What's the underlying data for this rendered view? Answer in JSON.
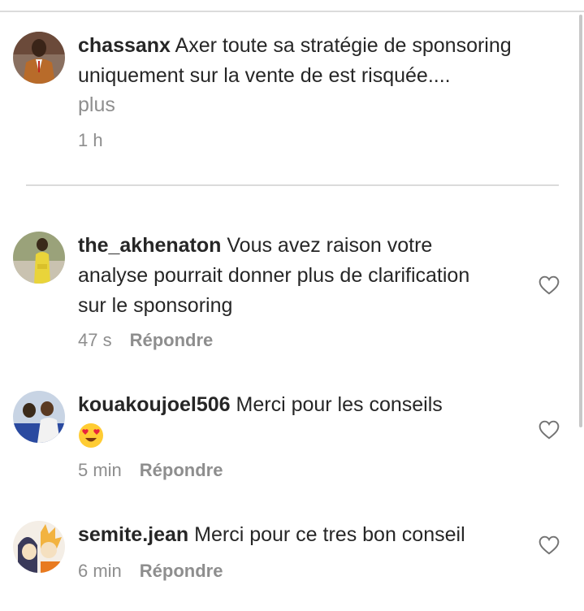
{
  "comments": [
    {
      "username": "chassanx",
      "text": " Axer toute sa stratégie de sponsoring uniquement sur la vente de est risquée....",
      "more": "plus",
      "time": "1 h",
      "reply": "",
      "avatar_colors": [
        "#6b4a3a",
        "#b86b2a",
        "#2a2a2a"
      ]
    },
    {
      "username": "the_akhenaton",
      "text": " Vous avez raison votre analyse pourrait donner plus de clarification sur le sponsoring",
      "time": "47 s",
      "reply": "Répondre",
      "avatar_colors": [
        "#7a8a5a",
        "#e9d43a",
        "#3a2a1a"
      ]
    },
    {
      "username": "kouakoujoel506",
      "text": " Merci pour les conseils",
      "emoji": "heart-eyes-emoji",
      "time": "5 min",
      "reply": "Répondre",
      "avatar_colors": [
        "#8aa0c8",
        "#2a4aa0",
        "#3a2a1a"
      ]
    },
    {
      "username": "semite.jean",
      "text": " Merci pour ce tres bon conseil",
      "time": "6 min",
      "reply": "Répondre",
      "avatar_colors": [
        "#f2b340",
        "#3a3a5a",
        "#f5e0c0"
      ]
    }
  ],
  "colors": {
    "text": "#262626",
    "muted": "#8e8e8e",
    "divider": "#dbdbdb"
  }
}
